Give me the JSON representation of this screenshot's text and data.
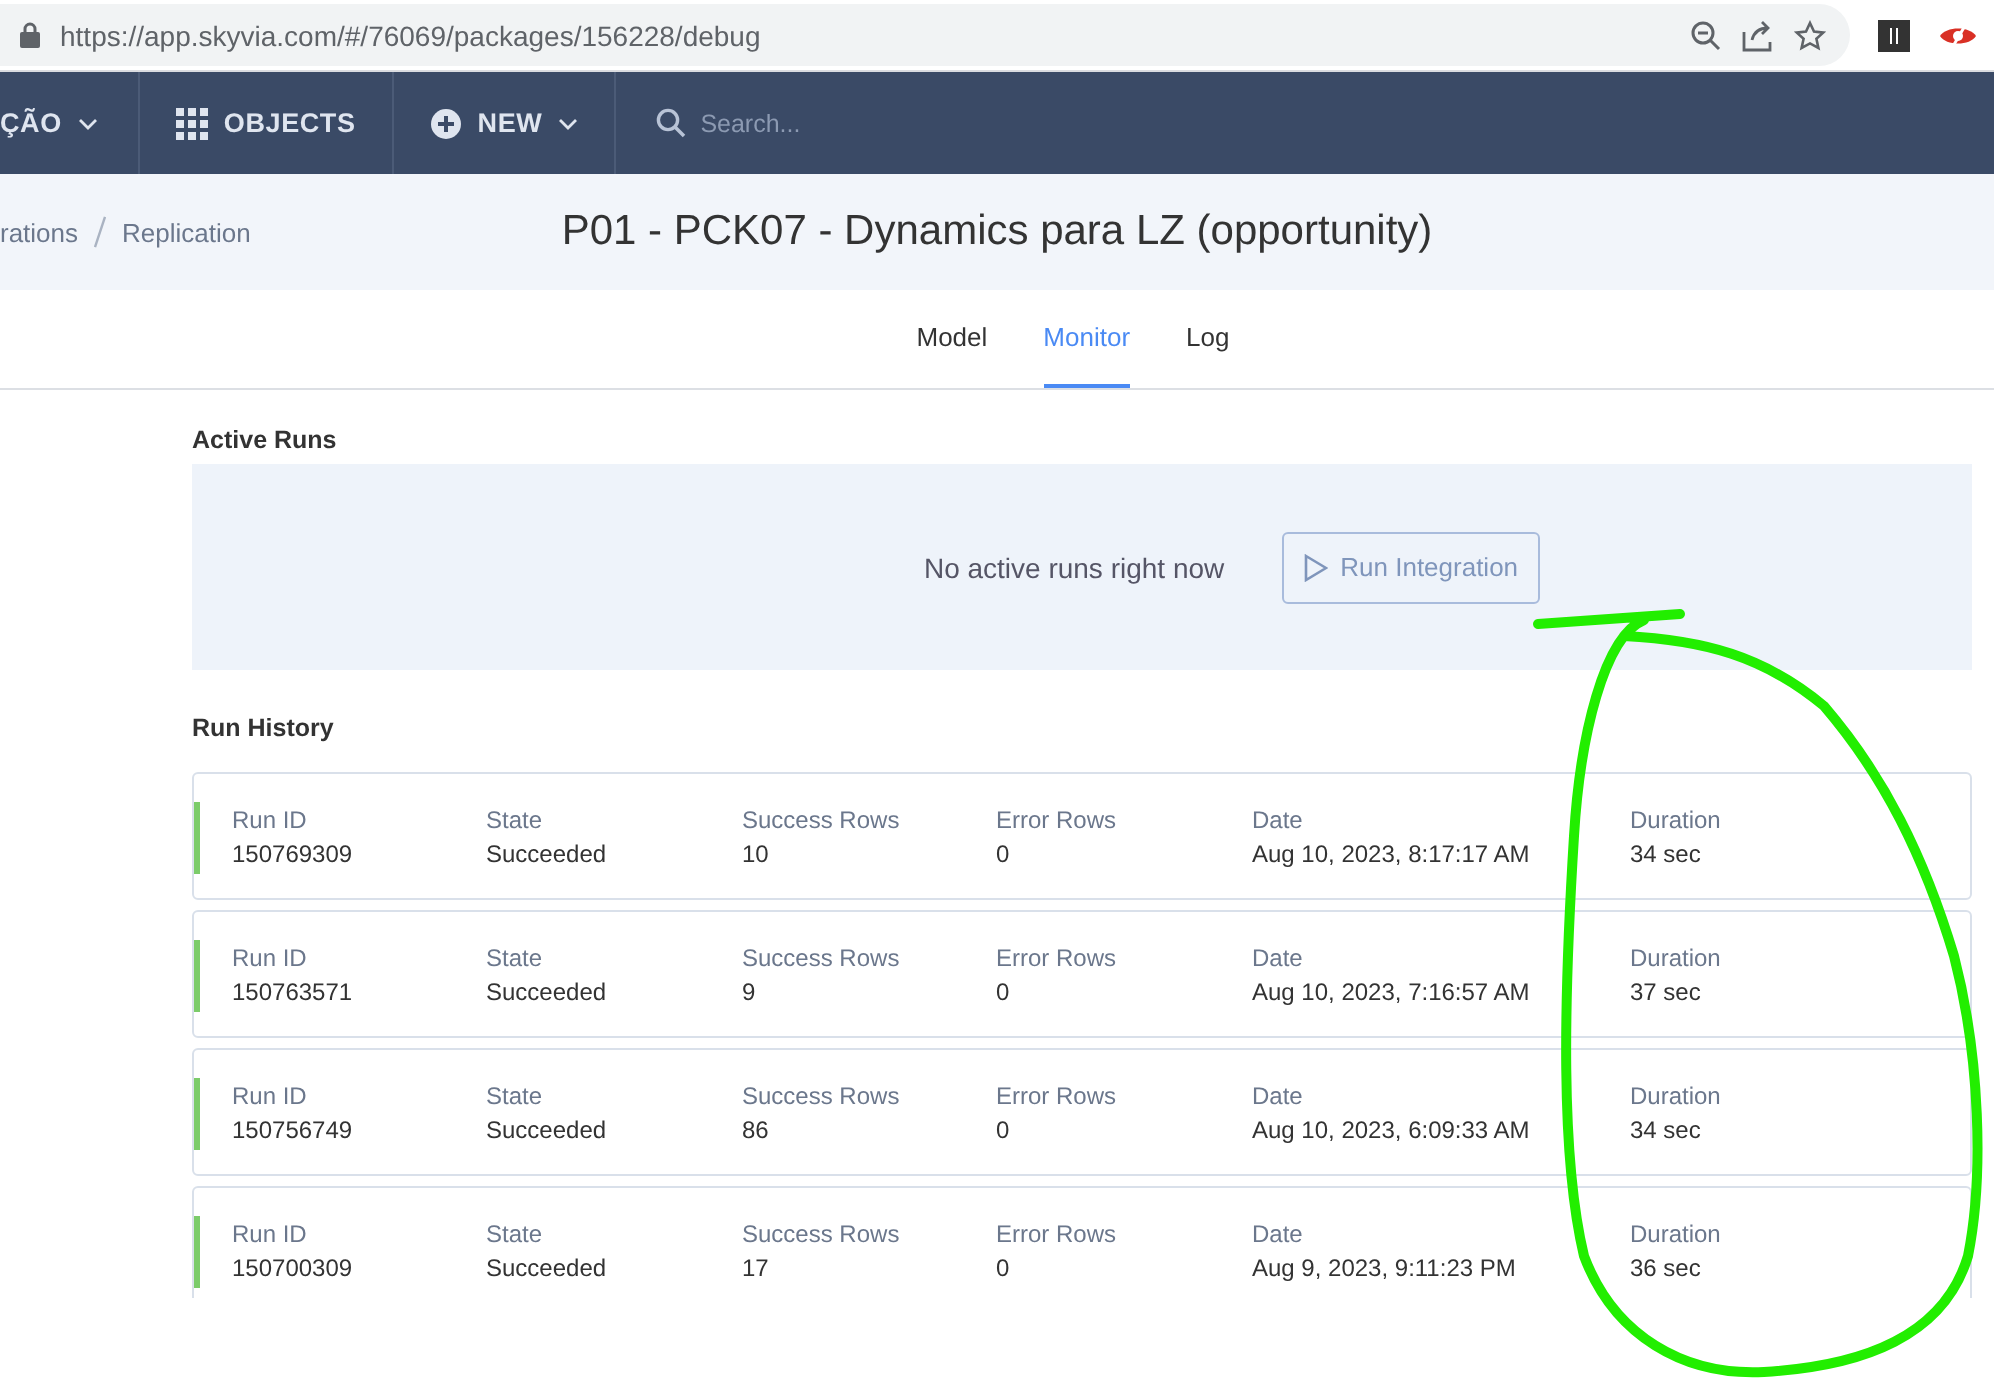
{
  "browser": {
    "url": "https://app.skyvia.com/#/76069/packages/156228/debug"
  },
  "nav": {
    "items": [
      {
        "label": "ÇÃO",
        "kind": "dropdown"
      },
      {
        "label": "OBJECTS",
        "kind": "grid"
      },
      {
        "label": "NEW",
        "kind": "new"
      }
    ],
    "search": {
      "placeholder": "Search..."
    }
  },
  "breadcrumb": [
    "rations",
    "Replication"
  ],
  "title": "P01 - PCK07 - Dynamics para LZ (opportunity)",
  "tabs": [
    {
      "label": "Model",
      "selected": false
    },
    {
      "label": "Monitor",
      "selected": true
    },
    {
      "label": "Log",
      "selected": false
    }
  ],
  "active_runs": {
    "heading": "Active Runs",
    "message": "No active runs right now",
    "button": {
      "label": "Run Integration",
      "disabled": true
    }
  },
  "run_history": {
    "heading": "Run History",
    "rows": [
      {
        "fields": [
          {
            "label": "Run ID",
            "value": "150769309"
          },
          {
            "label": "State",
            "value": "Succeeded"
          },
          {
            "label": "Success Rows",
            "value": "10"
          },
          {
            "label": "Error Rows",
            "value": "0"
          },
          {
            "label": "Date",
            "value": "Aug 10, 2023, 8:17:17 AM"
          },
          {
            "label": "Duration",
            "value": "34 sec"
          }
        ]
      },
      {
        "fields": [
          {
            "label": "Run ID",
            "value": "150763571"
          },
          {
            "label": "State",
            "value": "Succeeded"
          },
          {
            "label": "Success Rows",
            "value": "9"
          },
          {
            "label": "Error Rows",
            "value": "0"
          },
          {
            "label": "Date",
            "value": "Aug 10, 2023, 7:16:57 AM"
          },
          {
            "label": "Duration",
            "value": "37 sec"
          }
        ]
      },
      {
        "fields": [
          {
            "label": "Run ID",
            "value": "150756749"
          },
          {
            "label": "State",
            "value": "Succeeded"
          },
          {
            "label": "Success Rows",
            "value": "86"
          },
          {
            "label": "Error Rows",
            "value": "0"
          },
          {
            "label": "Date",
            "value": "Aug 10, 2023, 6:09:33 AM"
          },
          {
            "label": "Duration",
            "value": "34 sec"
          }
        ]
      },
      {
        "fields": [
          {
            "label": "Run ID",
            "value": "150700309"
          },
          {
            "label": "State",
            "value": "Succeeded"
          },
          {
            "label": "Success Rows",
            "value": "17"
          },
          {
            "label": "Error Rows",
            "value": "0"
          },
          {
            "label": "Date",
            "value": "Aug 9, 2023, 9:11:23 PM"
          },
          {
            "label": "Duration",
            "value": "36 sec"
          }
        ]
      }
    ]
  }
}
